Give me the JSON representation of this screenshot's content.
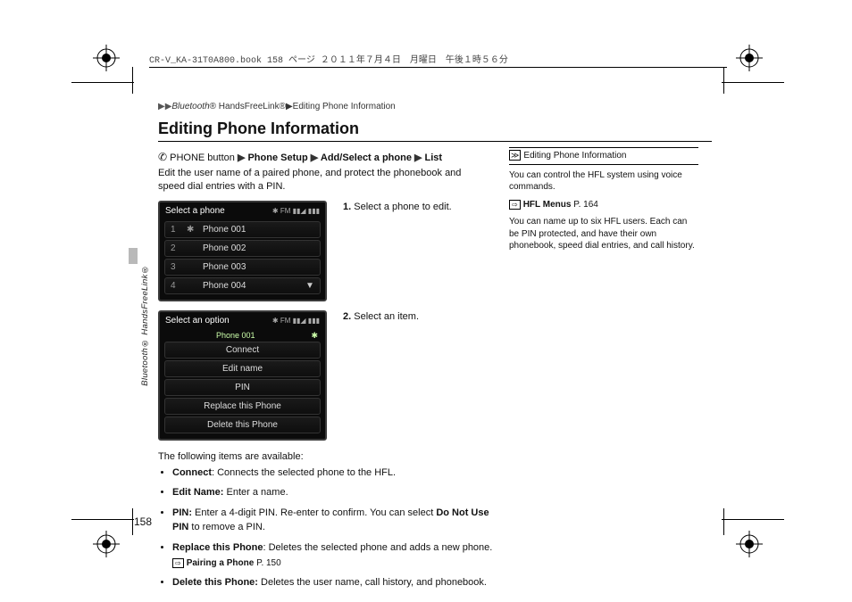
{
  "meta_header": "CR-V_KA-31T0A800.book  158 ページ  ２０１１年７月４日　月曜日　午後１時５６分",
  "running_head": {
    "prefix": "▶▶",
    "category_ital": "Bluetooth",
    "category_rest": "® HandsFreeLink®▶Editing Phone Information"
  },
  "title": "Editing Phone Information",
  "path": {
    "icon": "☺",
    "seg0": "PHONE button",
    "seg1": "Phone Setup",
    "seg2": "Add/Select a phone",
    "seg3": "List"
  },
  "intro": "Edit the user name of a paired phone, and protect the phonebook and speed dial entries with a PIN.",
  "screen1": {
    "title": "Select a phone",
    "status": "✱ FM ▮▮◢ ▮▮▮",
    "rows": [
      {
        "n": "1",
        "label": "Phone 001",
        "mark": "✱"
      },
      {
        "n": "2",
        "label": "Phone 002",
        "mark": ""
      },
      {
        "n": "3",
        "label": "Phone 003",
        "mark": ""
      },
      {
        "n": "4",
        "label": "Phone 004",
        "mark": ""
      }
    ],
    "scroll_glyph": "▼"
  },
  "step1": {
    "n": "1.",
    "text": "Select a phone to edit."
  },
  "screen2": {
    "title": "Select an option",
    "status": "✱ FM ▮▮◢ ▮▮▮",
    "sub": "Phone 001",
    "items": [
      "Connect",
      "Edit name",
      "PIN",
      "Replace this Phone",
      "Delete this Phone"
    ],
    "scroll_glyph": "✱"
  },
  "step2": {
    "n": "2.",
    "text": "Select an item."
  },
  "available_head": "The following items are available:",
  "bullets": [
    {
      "name": "Connect",
      "rest": ": Connects the selected phone to the HFL."
    },
    {
      "name": "Edit Name:",
      "rest": " Enter a name."
    },
    {
      "name": "PIN:",
      "rest": " Enter a 4-digit PIN. Re-enter to confirm. You can select ",
      "mid_bold": "Do Not Use PIN",
      "tail": " to remove a PIN."
    },
    {
      "name": "Replace this Phone",
      "rest": ": Deletes the selected phone and adds a new phone.",
      "ref": "Pairing a Phone",
      "ref_page": "P. 150"
    },
    {
      "name": "Delete this Phone:",
      "rest": " Deletes the user name, call history, and phonebook."
    }
  ],
  "page_number": "158",
  "side_text": "Bluetooth® HandsFreeLink®",
  "notes": {
    "head_sym": "≫",
    "head": "Editing Phone Information",
    "p1": "You can control the HFL system using voice commands.",
    "ref": "HFL Menus",
    "ref_page": "P. 164",
    "p2": "You can name up to six HFL users. Each can be PIN protected, and have their own phonebook, speed dial entries, and call history."
  }
}
